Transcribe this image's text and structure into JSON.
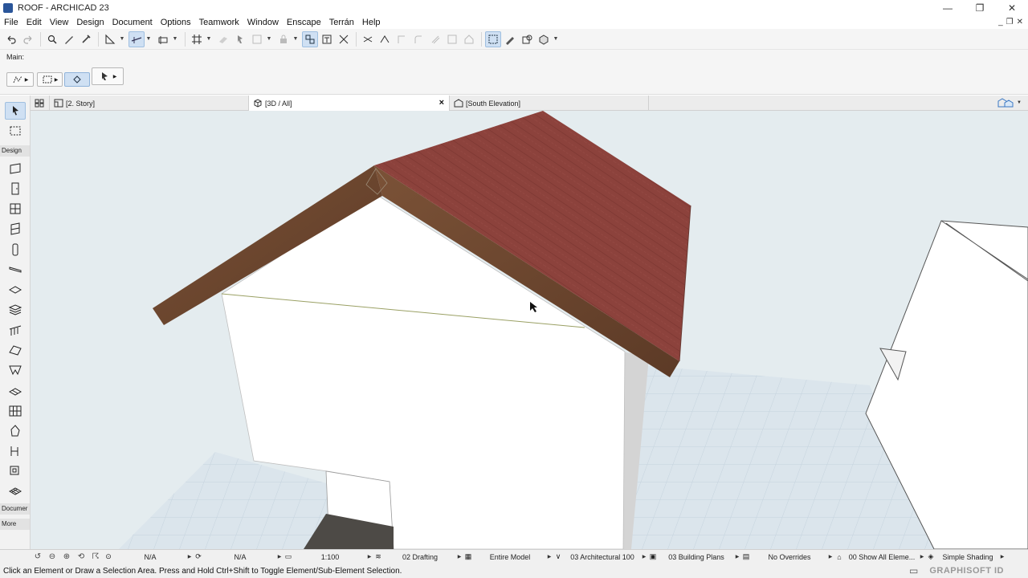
{
  "window": {
    "title": "ROOF - ARCHICAD 23",
    "controls": {
      "minimize": "—",
      "restore": "❐",
      "close": "✕"
    }
  },
  "menu": {
    "items": [
      "File",
      "Edit",
      "View",
      "Design",
      "Document",
      "Options",
      "Teamwork",
      "Window",
      "Enscape",
      "Terrán",
      "Help"
    ],
    "right_controls": [
      "_",
      "❐",
      "✕"
    ]
  },
  "infobox": {
    "label": "Main:"
  },
  "tabs": [
    {
      "label": "[2. Story]",
      "icon": "floor-plan-icon",
      "active": false
    },
    {
      "label": "[3D / All]",
      "icon": "3d-view-icon",
      "active": true,
      "close": "×"
    },
    {
      "label": "[South Elevation]",
      "icon": "elevation-icon",
      "active": false
    }
  ],
  "toolbox": {
    "sections": [
      "Design",
      "Documer",
      "More"
    ]
  },
  "bottom": {
    "fields": [
      {
        "icon": "zoom-icon",
        "text": "N/A"
      },
      {
        "icon": "rotate-icon",
        "text": "N/A"
      },
      {
        "icon": "scale-icon",
        "text": "1:100"
      },
      {
        "icon": "layers-icon",
        "text": "02 Drafting"
      },
      {
        "icon": "model-view-icon",
        "text": "Entire Model"
      },
      {
        "icon": "pen-set-icon",
        "text": "03 Architectural 100"
      },
      {
        "icon": "model-view-options-icon",
        "text": "03 Building Plans"
      },
      {
        "icon": "overrides-icon",
        "text": "No Overrides"
      },
      {
        "icon": "renovation-icon",
        "text": "00 Show All Eleme..."
      },
      {
        "icon": "shading-icon",
        "text": "Simple Shading"
      }
    ]
  },
  "status": {
    "text": "Click an Element or Draw a Selection Area. Press and Hold Ctrl+Shift to Toggle Element/Sub-Element Selection.",
    "brand": "GRAPHISOFT ID"
  },
  "colors": {
    "roof": "#8c423c",
    "roof_edge": "#6a4530",
    "wall": "#ffffff",
    "ground": "#dbe5ec",
    "background": "#e4ecef",
    "accent": "#cfe0f3"
  }
}
